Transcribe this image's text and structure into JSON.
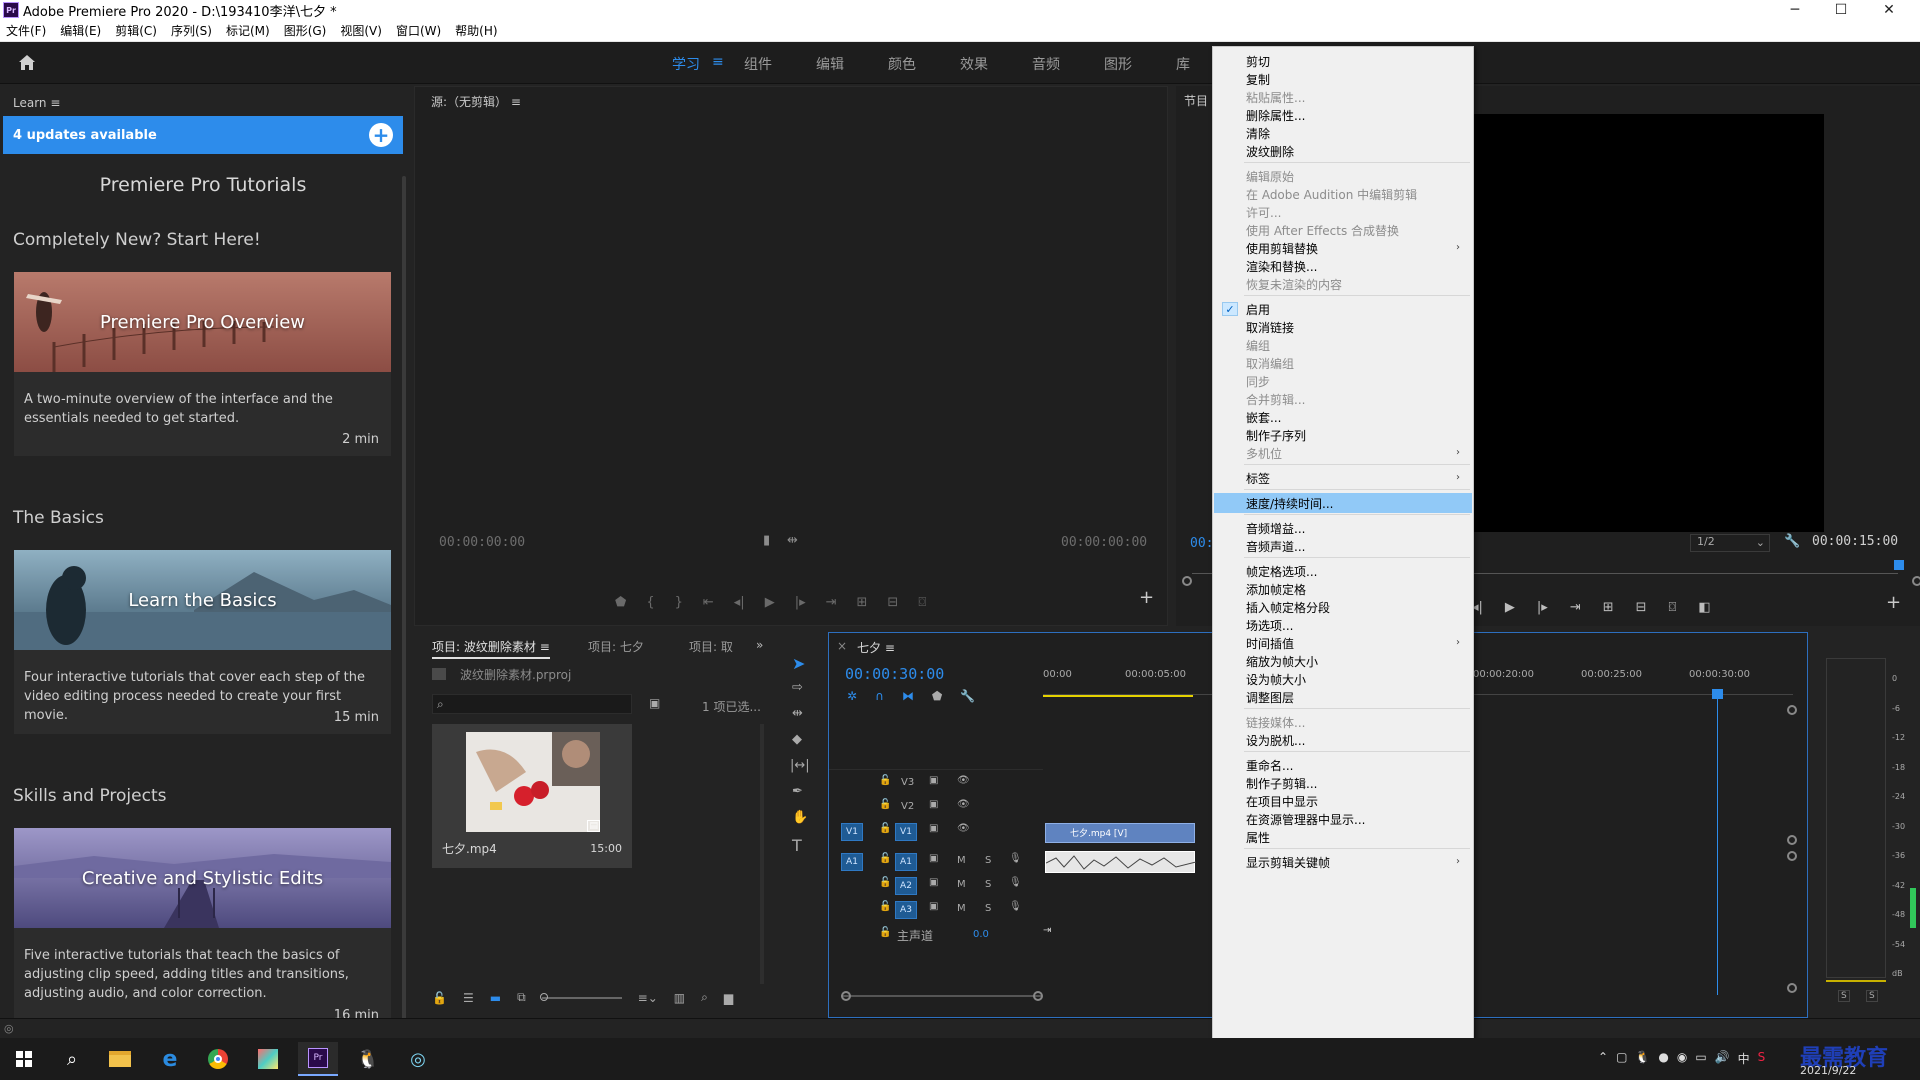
{
  "window": {
    "title": "Adobe Premiere Pro 2020 - D:\\193410李洋\\七夕 *",
    "app_badge": "Pr",
    "min": "─",
    "max": "☐",
    "close": "✕"
  },
  "menubar": [
    "文件(F)",
    "编辑(E)",
    "剪辑(C)",
    "序列(S)",
    "标记(M)",
    "图形(G)",
    "视图(V)",
    "窗口(W)",
    "帮助(H)"
  ],
  "workspace": {
    "tabs": [
      "学习",
      "组件",
      "编辑",
      "颜色",
      "效果",
      "音频",
      "图形",
      "库"
    ],
    "active": "学习",
    "menu_glyph": "≡",
    "accent": "#2d8ceb"
  },
  "learn": {
    "header": "Learn",
    "updates": "4 updates available",
    "title": "Premiere Pro Tutorials",
    "sections": [
      {
        "heading": "Completely New? Start Here!",
        "card_title": "Premiere Pro Overview",
        "desc": "A two-minute overview of the interface and the essentials needed to get started.",
        "duration": "2 min"
      },
      {
        "heading": "The Basics",
        "card_title": "Learn the Basics",
        "desc": "Four interactive tutorials that cover each step of the video editing process needed to create your first movie.",
        "duration": "15 min"
      },
      {
        "heading": "Skills and Projects",
        "card_title": "Creative and Stylistic Edits",
        "desc": "Five interactive tutorials that teach the basics of adjusting clip speed, adding titles and transitions, adjusting audio, and color correction.",
        "duration": "16 min"
      }
    ]
  },
  "source": {
    "header": "源:（无剪辑）",
    "tc_left": "00:00:00:00",
    "tc_right": "00:00:00:00"
  },
  "program": {
    "header": "节目",
    "tc_left": "00:",
    "scale": "1/2",
    "tc_right": "00:00:15:00"
  },
  "project": {
    "tabs": [
      "项目: 波纹删除素材",
      "项目: 七夕",
      "项目: 取"
    ],
    "file": "波纹删除素材.prproj",
    "selected": "1 项已选...",
    "clip_name": "七夕.mp4",
    "clip_dur": "15:00"
  },
  "timeline": {
    "tab": "七夕",
    "timecode": "00:00:30:00",
    "ruler": [
      "00:00",
      "00:00:05:00",
      "00:00:20:00",
      "00:00:25:00",
      "00:00:30:00"
    ],
    "tracks_video": [
      "V3",
      "V2",
      "V1"
    ],
    "tracks_audio": [
      "A1",
      "A2",
      "A3"
    ],
    "src_v": "V1",
    "src_a": "A1",
    "master": "主声道",
    "master_val": "0.0",
    "clip_label": "七夕.mp4 [V]",
    "mute": "M",
    "solo": "S"
  },
  "audio_meter": {
    "scale": [
      "0",
      "-6",
      "-12",
      "-18",
      "-24",
      "-30",
      "-36",
      "-42",
      "-48",
      "-54",
      "dB"
    ],
    "solo": "S"
  },
  "context_menu": {
    "items": [
      {
        "label": "剪切",
        "enabled": true
      },
      {
        "label": "复制",
        "enabled": true
      },
      {
        "label": "粘贴属性...",
        "enabled": false
      },
      {
        "label": "删除属性...",
        "enabled": true
      },
      {
        "label": "清除",
        "enabled": true
      },
      {
        "label": "波纹删除",
        "enabled": true
      },
      {
        "sep": true
      },
      {
        "label": "编辑原始",
        "enabled": false
      },
      {
        "label": "在 Adobe Audition 中编辑剪辑",
        "enabled": false
      },
      {
        "label": "许可...",
        "enabled": false
      },
      {
        "label": "使用 After Effects 合成替换",
        "enabled": false
      },
      {
        "label": "使用剪辑替换",
        "enabled": true,
        "submenu": true
      },
      {
        "label": "渲染和替换...",
        "enabled": true
      },
      {
        "label": "恢复未渲染的内容",
        "enabled": false
      },
      {
        "sep": true
      },
      {
        "label": "启用",
        "enabled": true,
        "checked": true
      },
      {
        "label": "取消链接",
        "enabled": true
      },
      {
        "label": "编组",
        "enabled": false
      },
      {
        "label": "取消编组",
        "enabled": false
      },
      {
        "label": "同步",
        "enabled": false
      },
      {
        "label": "合并剪辑...",
        "enabled": false
      },
      {
        "label": "嵌套...",
        "enabled": true
      },
      {
        "label": "制作子序列",
        "enabled": true
      },
      {
        "label": "多机位",
        "enabled": false,
        "submenu": true
      },
      {
        "sep": true
      },
      {
        "label": "标签",
        "enabled": true,
        "submenu": true
      },
      {
        "sep": true
      },
      {
        "label": "速度/持续时间...",
        "enabled": true,
        "highlight": true
      },
      {
        "sep": true
      },
      {
        "label": "音频增益...",
        "enabled": true
      },
      {
        "label": "音频声道...",
        "enabled": true
      },
      {
        "sep": true
      },
      {
        "label": "帧定格选项...",
        "enabled": true
      },
      {
        "label": "添加帧定格",
        "enabled": true
      },
      {
        "label": "插入帧定格分段",
        "enabled": true
      },
      {
        "label": "场选项...",
        "enabled": true
      },
      {
        "label": "时间插值",
        "enabled": true,
        "submenu": true
      },
      {
        "label": "缩放为帧大小",
        "enabled": true
      },
      {
        "label": "设为帧大小",
        "enabled": true
      },
      {
        "label": "调整图层",
        "enabled": true
      },
      {
        "sep": true
      },
      {
        "label": "链接媒体...",
        "enabled": false
      },
      {
        "label": "设为脱机...",
        "enabled": true
      },
      {
        "sep": true
      },
      {
        "label": "重命名...",
        "enabled": true
      },
      {
        "label": "制作子剪辑...",
        "enabled": true
      },
      {
        "label": "在项目中显示",
        "enabled": true
      },
      {
        "label": "在资源管理器中显示...",
        "enabled": true
      },
      {
        "label": "属性",
        "enabled": true
      },
      {
        "sep": true
      },
      {
        "label": "显示剪辑关键帧",
        "enabled": true,
        "submenu": true
      }
    ]
  },
  "taskbar": {
    "ime": "中",
    "date": "2021/9/22",
    "watermark": "最需教育"
  },
  "icons": {
    "home": "home-icon",
    "plus": "plus-icon",
    "search": "search-icon",
    "check": "✓",
    "submenu_arrow": "›"
  }
}
